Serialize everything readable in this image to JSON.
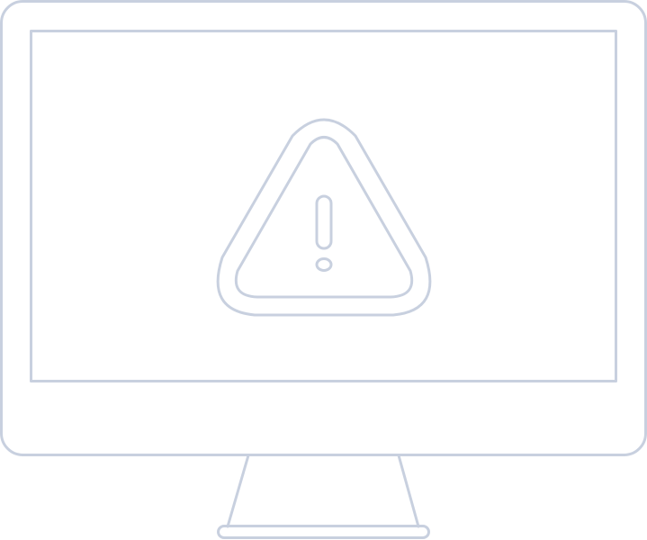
{
  "illustration": {
    "stroke_color": "#c8d0df",
    "background": "#ffffff",
    "icons": [
      "monitor-icon",
      "warning-triangle-icon",
      "exclamation-icon"
    ]
  }
}
